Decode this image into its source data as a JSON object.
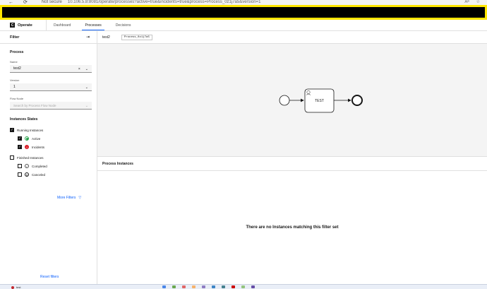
{
  "browser": {
    "back_icon": "←",
    "reload_icon": "⟳",
    "security": "Not secure",
    "url": "10.106.5.8:8081/operate/processes?active=true&incidents=true&process=Process_0z1j7a5&version=1",
    "read_aloud_icon": "Aᵃ",
    "favorite_icon": "☆"
  },
  "header": {
    "logo_letter": "C",
    "brand": "Operate",
    "tabs": [
      {
        "label": "Dashboard"
      },
      {
        "label": "Processes"
      },
      {
        "label": "Decisions"
      }
    ],
    "active_tab": "Processes"
  },
  "filters": {
    "title": "Filter",
    "process_section": "Process",
    "name_label": "Name",
    "name_value": "test2",
    "clear_icon": "×",
    "chevron_icon": "⌄",
    "version_label": "Version",
    "version_value": "1",
    "flow_node_label": "Flow Node",
    "flow_node_placeholder": "Search by Process Flow Node",
    "instances_states": "Instances States",
    "running_instances": "Running Instances",
    "active": "Active",
    "incidents": "Incidents",
    "incident_icon": "!",
    "finished_instances": "Finished Instances",
    "completed": "Completed",
    "completed_icon": "✓",
    "canceled": "Canceled",
    "canceled_icon": "⦸",
    "check_icon": "✓",
    "more_filters": "More Filters",
    "filter_icon": "▽",
    "reset_filters": "Reset filters",
    "collapse_icon": "⇥"
  },
  "diagram": {
    "process_name": "test2",
    "process_id": "Process_0z1j7a5",
    "task_label": "TEST"
  },
  "instances": {
    "title": "Process Instances",
    "empty_message": "There are no Instances matching this filter set"
  },
  "taskbar": {
    "tab_label": "test",
    "app_colors": [
      "#4a86e8",
      "#6aa84f",
      "#e06666",
      "#f6b26b",
      "#8e7cc3",
      "#3d85c6",
      "#45818e",
      "#cc0000",
      "#93c47d",
      "#674ea7"
    ]
  }
}
